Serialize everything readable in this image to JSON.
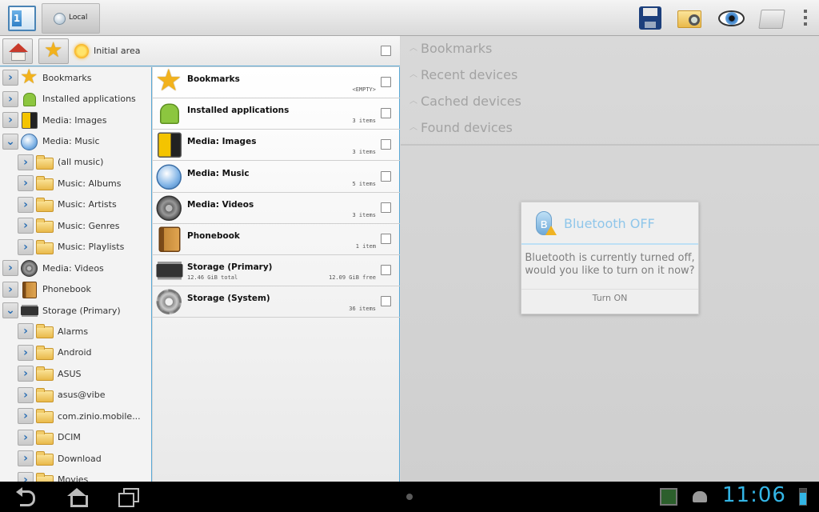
{
  "topbar": {
    "app_icon_text": "1",
    "tab_local_label": "Local",
    "actions": [
      "save-icon",
      "folder-search-icon",
      "eye-icon",
      "folder-icon",
      "overflow-menu-icon"
    ]
  },
  "header": {
    "location_label": "Initial area"
  },
  "tree": {
    "items": [
      {
        "label": "Bookmarks",
        "expanded": false,
        "level": 0,
        "icon": "star-icon"
      },
      {
        "label": "Installed applications",
        "expanded": false,
        "level": 0,
        "icon": "android-icon"
      },
      {
        "label": "Media: Images",
        "expanded": false,
        "level": 0,
        "icon": "film-icon"
      },
      {
        "label": "Media: Music",
        "expanded": true,
        "level": 0,
        "icon": "music-icon"
      },
      {
        "label": "(all music)",
        "expanded": false,
        "level": 1,
        "icon": "folder-icon"
      },
      {
        "label": "Music: Albums",
        "expanded": false,
        "level": 1,
        "icon": "folder-icon"
      },
      {
        "label": "Music: Artists",
        "expanded": false,
        "level": 1,
        "icon": "folder-icon"
      },
      {
        "label": "Music: Genres",
        "expanded": false,
        "level": 1,
        "icon": "folder-icon"
      },
      {
        "label": "Music: Playlists",
        "expanded": false,
        "level": 1,
        "icon": "folder-icon"
      },
      {
        "label": "Media: Videos",
        "expanded": false,
        "level": 0,
        "icon": "film-reel-icon"
      },
      {
        "label": "Phonebook",
        "expanded": false,
        "level": 0,
        "icon": "phonebook-icon"
      },
      {
        "label": "Storage (Primary)",
        "expanded": true,
        "level": 0,
        "icon": "storage-chip-icon"
      },
      {
        "label": "Alarms",
        "expanded": false,
        "level": 1,
        "icon": "folder-icon"
      },
      {
        "label": "Android",
        "expanded": false,
        "level": 1,
        "icon": "folder-icon"
      },
      {
        "label": "ASUS",
        "expanded": false,
        "level": 1,
        "icon": "folder-icon"
      },
      {
        "label": "asus@vibe",
        "expanded": false,
        "level": 1,
        "icon": "folder-icon"
      },
      {
        "label": "com.zinio.mobile...",
        "expanded": false,
        "level": 1,
        "icon": "folder-icon"
      },
      {
        "label": "DCIM",
        "expanded": false,
        "level": 1,
        "icon": "folder-icon"
      },
      {
        "label": "Download",
        "expanded": false,
        "level": 1,
        "icon": "folder-icon"
      },
      {
        "label": "Movies",
        "expanded": false,
        "level": 1,
        "icon": "folder-icon"
      }
    ]
  },
  "list": {
    "items": [
      {
        "title": "Bookmarks",
        "subtitle": "",
        "meta": "<EMPTY>",
        "icon": "star-icon"
      },
      {
        "title": "Installed applications",
        "subtitle": "",
        "meta": "3 items",
        "icon": "android-icon"
      },
      {
        "title": "Media: Images",
        "subtitle": "",
        "meta": "3 items",
        "icon": "film-icon"
      },
      {
        "title": "Media: Music",
        "subtitle": "",
        "meta": "5 items",
        "icon": "music-icon"
      },
      {
        "title": "Media: Videos",
        "subtitle": "",
        "meta": "3 items",
        "icon": "film-reel-icon"
      },
      {
        "title": "Phonebook",
        "subtitle": "",
        "meta": "1 item",
        "icon": "phonebook-icon"
      },
      {
        "title": "Storage (Primary)",
        "subtitle": "12.46 GiB total",
        "meta": "12.09 GiB free",
        "icon": "storage-chip-icon"
      },
      {
        "title": "Storage (System)",
        "subtitle": "",
        "meta": "36 items",
        "icon": "gear-icon"
      }
    ]
  },
  "right": {
    "sections": [
      "Bookmarks",
      "Recent devices",
      "Cached devices",
      "Found devices"
    ]
  },
  "dialog": {
    "title": "Bluetooth OFF",
    "message_line1": "Bluetooth is currently turned off,",
    "message_line2": "would you like to turn on it now?",
    "button": "Turn ON"
  },
  "sysbar": {
    "clock": "11:06"
  }
}
